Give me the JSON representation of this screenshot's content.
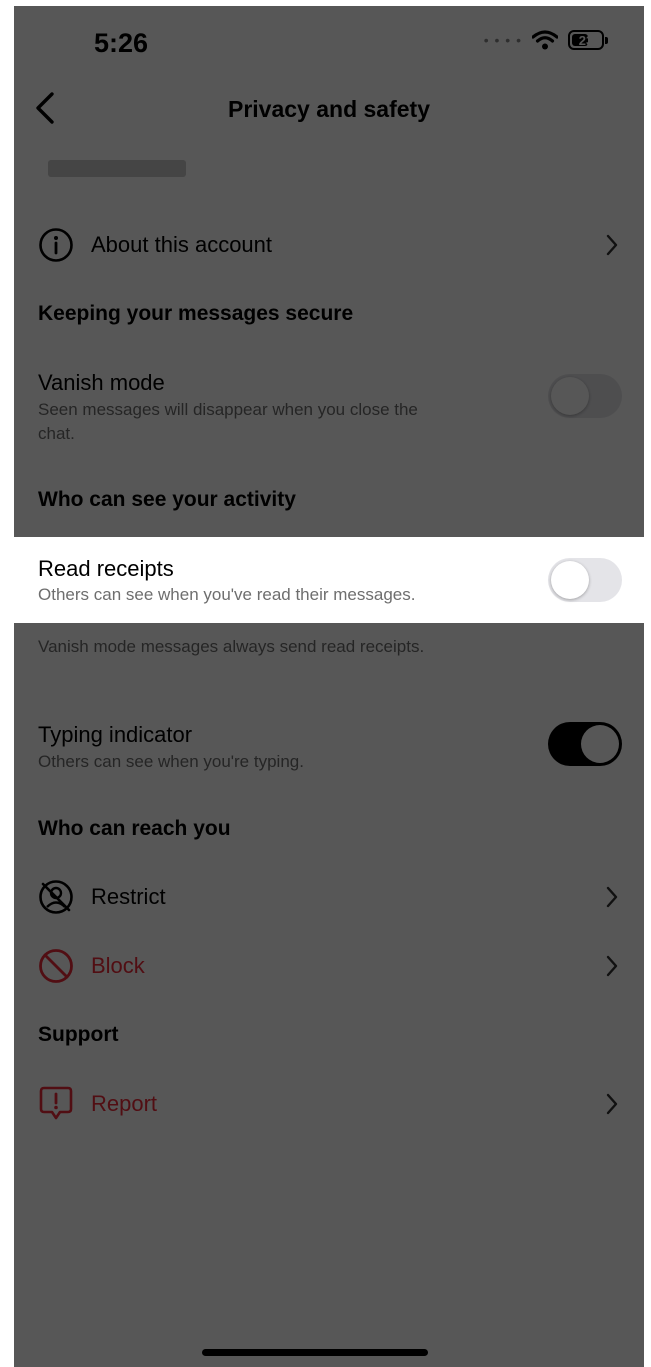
{
  "status_bar": {
    "time": "5:26",
    "battery": "23"
  },
  "header": {
    "title": "Privacy and safety"
  },
  "about": {
    "label": "About this account"
  },
  "sections": {
    "secure": "Keeping your messages secure",
    "activity": "Who can see your activity",
    "reach": "Who can reach you",
    "support": "Support"
  },
  "vanish_mode": {
    "label": "Vanish mode",
    "description_line1": "Seen messages will disappear when you close the",
    "description_line2": "chat.",
    "enabled": false
  },
  "read_receipts": {
    "label": "Read receipts",
    "description": "Others can see when you've read their messages.",
    "enabled": false,
    "footnote": "Vanish mode messages always send read receipts."
  },
  "typing_indicator": {
    "label": "Typing indicator",
    "description": "Others can see when you're typing.",
    "enabled": true
  },
  "restrict": {
    "label": "Restrict"
  },
  "block": {
    "label": "Block"
  },
  "report": {
    "label": "Report"
  },
  "colors": {
    "destructive": "#ed2a3a",
    "toggle_on": "#000000",
    "toggle_off": "#e4e4e8",
    "overlay": "rgba(0,0,0,0.66)"
  },
  "icons": [
    "chevron-left-icon",
    "info-icon",
    "chevron-right-icon",
    "restrict-icon",
    "block-icon",
    "report-icon",
    "wifi-icon",
    "battery-icon"
  ]
}
